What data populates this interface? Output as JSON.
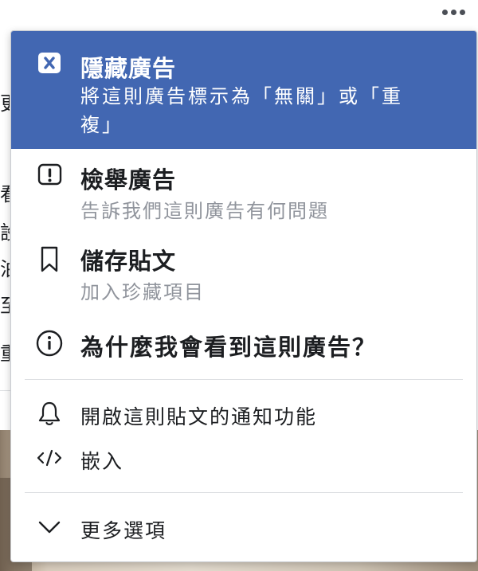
{
  "menu": {
    "items": [
      {
        "title": "隱藏廣告",
        "subtitle": "將這則廣告標示為「無關」或「重複」"
      },
      {
        "title": "檢舉廣告",
        "subtitle": "告訴我們這則廣告有何問題"
      },
      {
        "title": "儲存貼文",
        "subtitle": "加入珍藏項目"
      },
      {
        "title": "為什麼我會看到這則廣告？"
      }
    ],
    "secondary": [
      {
        "label": "開啟這則貼文的通知功能"
      },
      {
        "label": "嵌入"
      }
    ],
    "more": {
      "label": "更多選項"
    }
  },
  "background": {
    "fragments": [
      "更",
      "看",
      "設",
      "泊",
      "至",
      "重"
    ]
  },
  "colors": {
    "accent": "#4267b2",
    "text": "#1c1e21",
    "muted": "#90949c",
    "divider": "#dddfe2"
  },
  "icons": {
    "more": "more-horizontal-icon",
    "hide": "close-box-icon",
    "report": "exclamation-box-icon",
    "save": "bookmark-icon",
    "why": "info-circle-icon",
    "notify": "bell-icon",
    "embed": "code-icon",
    "expand": "chevron-down-icon"
  }
}
